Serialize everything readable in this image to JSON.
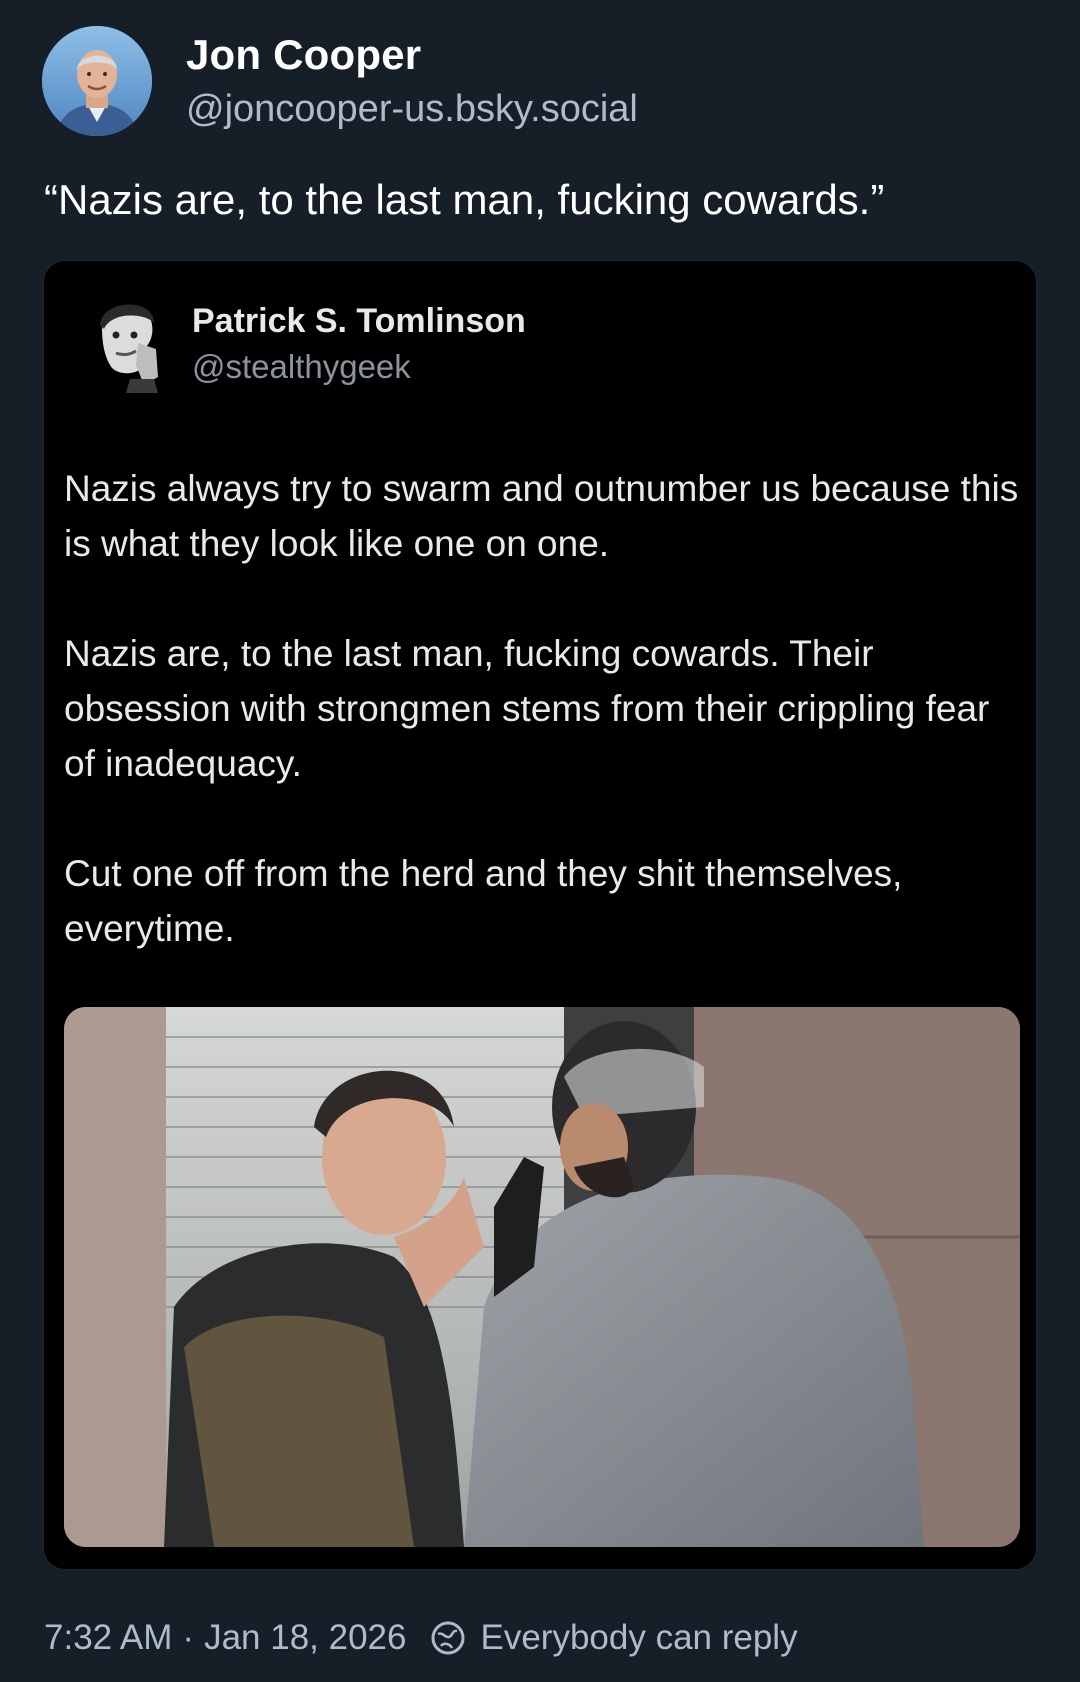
{
  "post": {
    "author": {
      "display_name": "Jon Cooper",
      "handle": "@joncooper-us.bsky.social",
      "avatar_icon": "avatar-photo"
    },
    "text": "“Nazis are, to the last man, fucking cowards.”",
    "timestamp": "7:32 AM",
    "separator": "·",
    "date": "Jan 18, 2026",
    "reply_setting": "Everybody can reply",
    "reply_icon": "globe-reply-icon"
  },
  "embed": {
    "author": {
      "display_name": "Patrick S. Tomlinson",
      "handle": "@stealthygeek"
    },
    "paragraphs": [
      "Nazis always try to swarm and outnumber us because this is what they look like one on one.",
      "Nazis are, to the last man, fucking cowards. Their obsession with strongmen stems from their crippling fear of inadequacy.",
      "Cut one off from the herd and they shit themselves, everytime."
    ]
  },
  "colors": {
    "background": "#161e27",
    "embed_background": "#000000",
    "muted_text": "#aebbc9"
  }
}
